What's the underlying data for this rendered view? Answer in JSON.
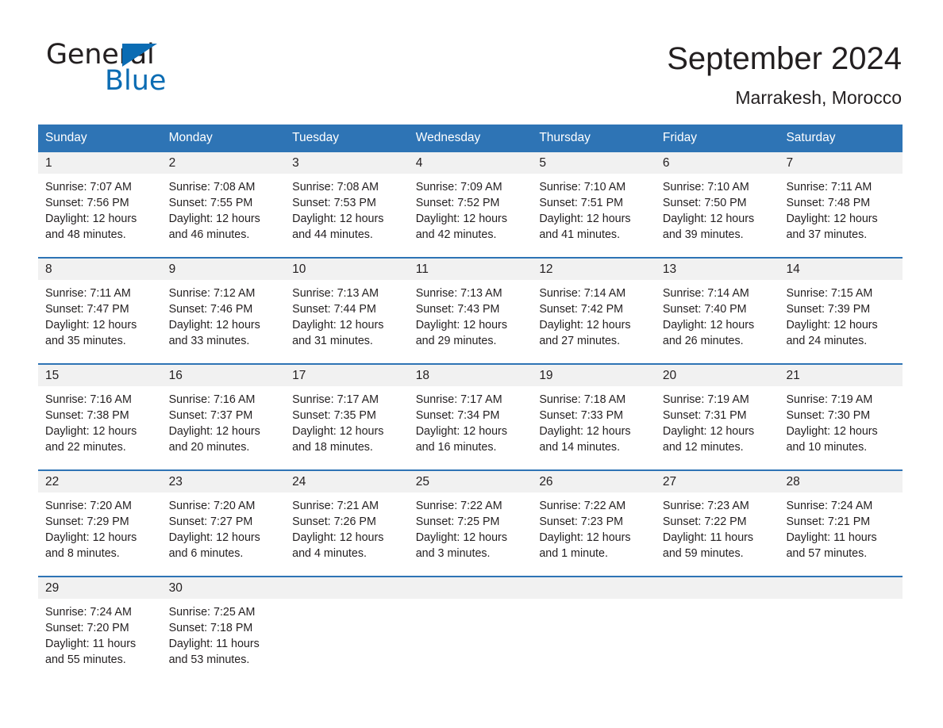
{
  "brand": {
    "name_dark": "General",
    "name_light": "Blue",
    "triangle_color": "#0b6cb3"
  },
  "header": {
    "title": "September 2024",
    "subtitle": "Marrakesh, Morocco"
  },
  "theme": {
    "header_blue": "#2e74b5",
    "day_band_gray": "#f1f1f1",
    "text": "#231f20"
  },
  "weekdays": [
    "Sunday",
    "Monday",
    "Tuesday",
    "Wednesday",
    "Thursday",
    "Friday",
    "Saturday"
  ],
  "weeks": [
    [
      {
        "day": "1",
        "sunrise": "Sunrise: 7:07 AM",
        "sunset": "Sunset: 7:56 PM",
        "daylight": "Daylight: 12 hours and 48 minutes."
      },
      {
        "day": "2",
        "sunrise": "Sunrise: 7:08 AM",
        "sunset": "Sunset: 7:55 PM",
        "daylight": "Daylight: 12 hours and 46 minutes."
      },
      {
        "day": "3",
        "sunrise": "Sunrise: 7:08 AM",
        "sunset": "Sunset: 7:53 PM",
        "daylight": "Daylight: 12 hours and 44 minutes."
      },
      {
        "day": "4",
        "sunrise": "Sunrise: 7:09 AM",
        "sunset": "Sunset: 7:52 PM",
        "daylight": "Daylight: 12 hours and 42 minutes."
      },
      {
        "day": "5",
        "sunrise": "Sunrise: 7:10 AM",
        "sunset": "Sunset: 7:51 PM",
        "daylight": "Daylight: 12 hours and 41 minutes."
      },
      {
        "day": "6",
        "sunrise": "Sunrise: 7:10 AM",
        "sunset": "Sunset: 7:50 PM",
        "daylight": "Daylight: 12 hours and 39 minutes."
      },
      {
        "day": "7",
        "sunrise": "Sunrise: 7:11 AM",
        "sunset": "Sunset: 7:48 PM",
        "daylight": "Daylight: 12 hours and 37 minutes."
      }
    ],
    [
      {
        "day": "8",
        "sunrise": "Sunrise: 7:11 AM",
        "sunset": "Sunset: 7:47 PM",
        "daylight": "Daylight: 12 hours and 35 minutes."
      },
      {
        "day": "9",
        "sunrise": "Sunrise: 7:12 AM",
        "sunset": "Sunset: 7:46 PM",
        "daylight": "Daylight: 12 hours and 33 minutes."
      },
      {
        "day": "10",
        "sunrise": "Sunrise: 7:13 AM",
        "sunset": "Sunset: 7:44 PM",
        "daylight": "Daylight: 12 hours and 31 minutes."
      },
      {
        "day": "11",
        "sunrise": "Sunrise: 7:13 AM",
        "sunset": "Sunset: 7:43 PM",
        "daylight": "Daylight: 12 hours and 29 minutes."
      },
      {
        "day": "12",
        "sunrise": "Sunrise: 7:14 AM",
        "sunset": "Sunset: 7:42 PM",
        "daylight": "Daylight: 12 hours and 27 minutes."
      },
      {
        "day": "13",
        "sunrise": "Sunrise: 7:14 AM",
        "sunset": "Sunset: 7:40 PM",
        "daylight": "Daylight: 12 hours and 26 minutes."
      },
      {
        "day": "14",
        "sunrise": "Sunrise: 7:15 AM",
        "sunset": "Sunset: 7:39 PM",
        "daylight": "Daylight: 12 hours and 24 minutes."
      }
    ],
    [
      {
        "day": "15",
        "sunrise": "Sunrise: 7:16 AM",
        "sunset": "Sunset: 7:38 PM",
        "daylight": "Daylight: 12 hours and 22 minutes."
      },
      {
        "day": "16",
        "sunrise": "Sunrise: 7:16 AM",
        "sunset": "Sunset: 7:37 PM",
        "daylight": "Daylight: 12 hours and 20 minutes."
      },
      {
        "day": "17",
        "sunrise": "Sunrise: 7:17 AM",
        "sunset": "Sunset: 7:35 PM",
        "daylight": "Daylight: 12 hours and 18 minutes."
      },
      {
        "day": "18",
        "sunrise": "Sunrise: 7:17 AM",
        "sunset": "Sunset: 7:34 PM",
        "daylight": "Daylight: 12 hours and 16 minutes."
      },
      {
        "day": "19",
        "sunrise": "Sunrise: 7:18 AM",
        "sunset": "Sunset: 7:33 PM",
        "daylight": "Daylight: 12 hours and 14 minutes."
      },
      {
        "day": "20",
        "sunrise": "Sunrise: 7:19 AM",
        "sunset": "Sunset: 7:31 PM",
        "daylight": "Daylight: 12 hours and 12 minutes."
      },
      {
        "day": "21",
        "sunrise": "Sunrise: 7:19 AM",
        "sunset": "Sunset: 7:30 PM",
        "daylight": "Daylight: 12 hours and 10 minutes."
      }
    ],
    [
      {
        "day": "22",
        "sunrise": "Sunrise: 7:20 AM",
        "sunset": "Sunset: 7:29 PM",
        "daylight": "Daylight: 12 hours and 8 minutes."
      },
      {
        "day": "23",
        "sunrise": "Sunrise: 7:20 AM",
        "sunset": "Sunset: 7:27 PM",
        "daylight": "Daylight: 12 hours and 6 minutes."
      },
      {
        "day": "24",
        "sunrise": "Sunrise: 7:21 AM",
        "sunset": "Sunset: 7:26 PM",
        "daylight": "Daylight: 12 hours and 4 minutes."
      },
      {
        "day": "25",
        "sunrise": "Sunrise: 7:22 AM",
        "sunset": "Sunset: 7:25 PM",
        "daylight": "Daylight: 12 hours and 3 minutes."
      },
      {
        "day": "26",
        "sunrise": "Sunrise: 7:22 AM",
        "sunset": "Sunset: 7:23 PM",
        "daylight": "Daylight: 12 hours and 1 minute."
      },
      {
        "day": "27",
        "sunrise": "Sunrise: 7:23 AM",
        "sunset": "Sunset: 7:22 PM",
        "daylight": "Daylight: 11 hours and 59 minutes."
      },
      {
        "day": "28",
        "sunrise": "Sunrise: 7:24 AM",
        "sunset": "Sunset: 7:21 PM",
        "daylight": "Daylight: 11 hours and 57 minutes."
      }
    ],
    [
      {
        "day": "29",
        "sunrise": "Sunrise: 7:24 AM",
        "sunset": "Sunset: 7:20 PM",
        "daylight": "Daylight: 11 hours and 55 minutes."
      },
      {
        "day": "30",
        "sunrise": "Sunrise: 7:25 AM",
        "sunset": "Sunset: 7:18 PM",
        "daylight": "Daylight: 11 hours and 53 minutes."
      },
      {
        "day": "",
        "sunrise": "",
        "sunset": "",
        "daylight": ""
      },
      {
        "day": "",
        "sunrise": "",
        "sunset": "",
        "daylight": ""
      },
      {
        "day": "",
        "sunrise": "",
        "sunset": "",
        "daylight": ""
      },
      {
        "day": "",
        "sunrise": "",
        "sunset": "",
        "daylight": ""
      },
      {
        "day": "",
        "sunrise": "",
        "sunset": "",
        "daylight": ""
      }
    ]
  ]
}
